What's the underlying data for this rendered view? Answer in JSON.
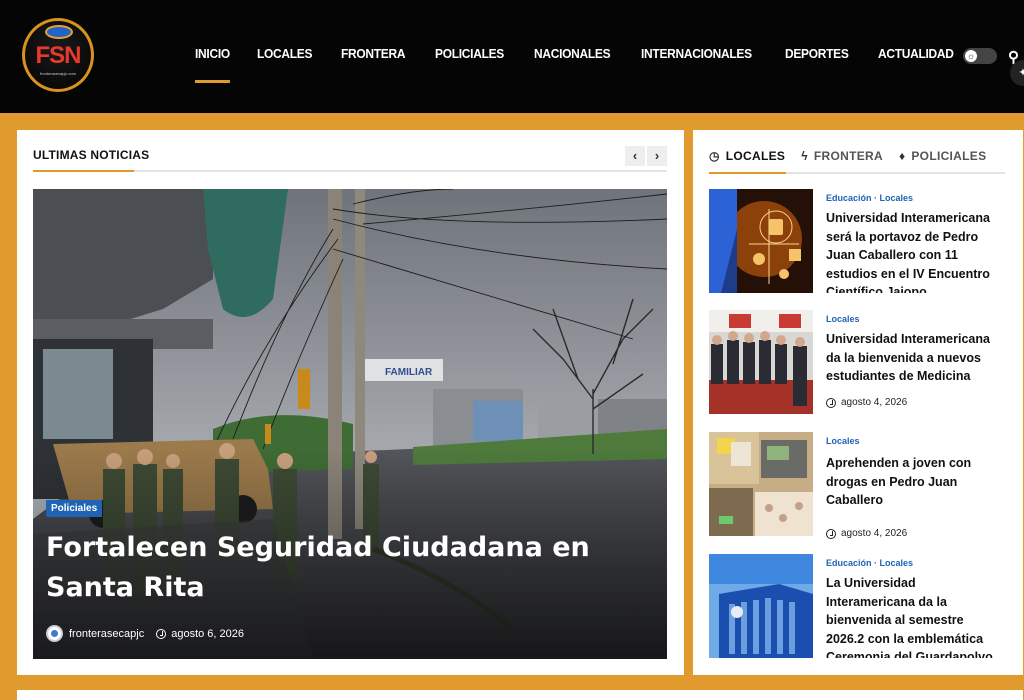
{
  "header": {
    "logo_text": "FSN",
    "logo_subtext": "fronterasecapjc.com",
    "nav": [
      "INICIO",
      "LOCALES",
      "FRONTERA",
      "POLICIALES",
      "NACIONALES",
      "INTERNACIONALES",
      "DEPORTES",
      "ACTUALIDAD"
    ],
    "active_nav": "INICIO"
  },
  "left": {
    "section_title": "ULTIMAS NOTICIAS",
    "hero": {
      "category": "Policiales",
      "title": "Fortalecen Seguridad Ciudadana en Santa Rita",
      "author": "fronterasecapjc",
      "date": "agosto 6, 2026",
      "sign_text": "FAMILIAR"
    }
  },
  "right": {
    "tabs": [
      {
        "label": "LOCALES",
        "icon": "clock-icon"
      },
      {
        "label": "FRONTERA",
        "icon": "bolt-icon"
      },
      {
        "label": "POLICIALES",
        "icon": "flame-icon"
      }
    ],
    "items": [
      {
        "cats": "Educación · Locales",
        "title": "Universidad Interamericana será la portavoz de Pedro Juan Caballero con 11 estudios en el IV Encuentro Científico Jaiopo",
        "date": ""
      },
      {
        "cats": "Locales",
        "title": "Universidad Interamericana da la bienvenida a nuevos estudiantes de Medicina",
        "date": "agosto 4, 2026"
      },
      {
        "cats": "Locales",
        "title": "Aprehenden a joven con drogas en Pedro Juan Caballero",
        "date": "agosto 4, 2026"
      },
      {
        "cats": "Educación · Locales",
        "title": "La Universidad Interamericana da la bienvenida al semestre 2026.2 con la emblemática Ceremonia del Guardapolvo",
        "date": ""
      }
    ]
  }
}
